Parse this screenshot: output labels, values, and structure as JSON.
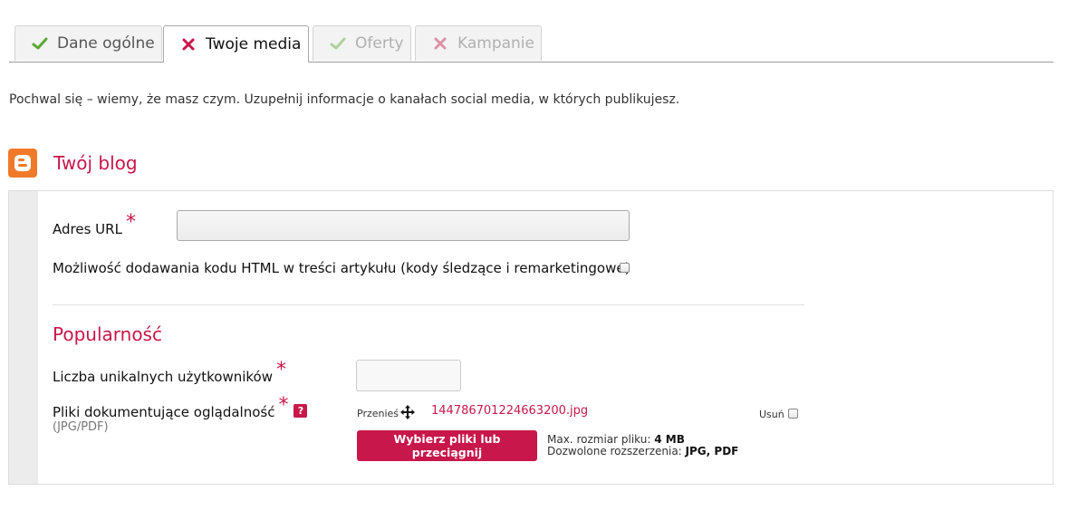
{
  "tabs": [
    {
      "label": "Dane ogólne",
      "status": "done"
    },
    {
      "label": "Twoje media",
      "status": "error"
    },
    {
      "label": "Oferty",
      "status": "done"
    },
    {
      "label": "Kampanie",
      "status": "error"
    }
  ],
  "intro": "Pochwal się – wiemy, że masz czym. Uzupełnij informacje o kanałach social media, w których publikujesz.",
  "blog": {
    "heading": "Twój blog",
    "url_label": "Adres URL",
    "url_value": "",
    "html_label": "Możliwość dodawania kodu HTML w treści artykułu (kody śledzące i remarketingowe)",
    "html_checked": false
  },
  "popularity": {
    "heading": "Popularność",
    "users_label": "Liczba unikalnych użytkowników",
    "users_value": "",
    "files_label": "Pliki dokumentujące oglądalność",
    "files_help": "?",
    "files_note": "(JPG/PDF)",
    "move_label": "Przenieś",
    "file_name": "144786701224663200.jpg",
    "remove_label": "Usuń",
    "remove_checked": false,
    "upload_button": "Wybierz pliki lub przeciągnij",
    "max_size_label": "Max. rozmiar pliku:",
    "max_size_value": "4 MB",
    "extensions_label": "Dozwolone rozszerzenia:",
    "extensions_value": "JPG, PDF"
  },
  "required_mark": "*",
  "colors": {
    "accent": "#c8174a",
    "check_green": "#5aa832",
    "blogger_orange": "#f07a2a"
  }
}
